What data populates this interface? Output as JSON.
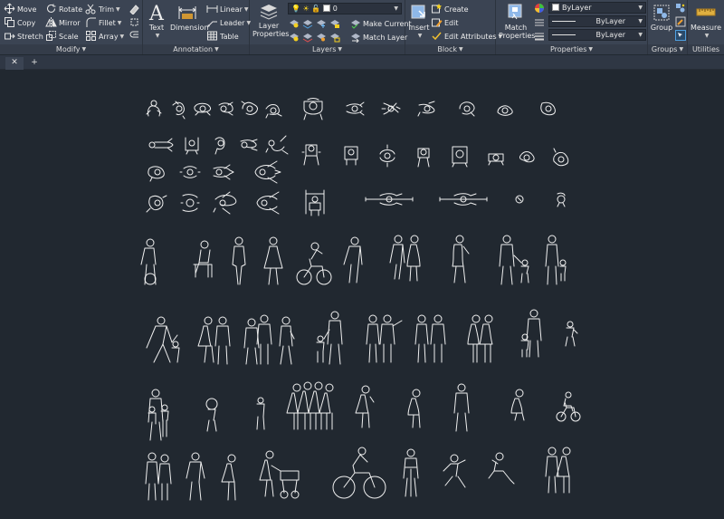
{
  "modify": {
    "title": "Modify",
    "move": "Move",
    "rotate": "Rotate",
    "trim": "Trim",
    "copy": "Copy",
    "mirror": "Mirror",
    "fillet": "Fillet",
    "stretch": "Stretch",
    "scale": "Scale",
    "array": "Array"
  },
  "annotation": {
    "title": "Annotation",
    "text": "Text",
    "dimension": "Dimension",
    "linear": "Linear",
    "leader": "Leader",
    "table": "Table"
  },
  "layers": {
    "title": "Layers",
    "layer_properties_line1": "Layer",
    "layer_properties_line2": "Properties",
    "current_layer": "0",
    "make_current": "Make Current",
    "match_layer": "Match Layer"
  },
  "block": {
    "title": "Block",
    "insert": "Insert",
    "create": "Create",
    "edit": "Edit",
    "edit_attributes": "Edit Attributes"
  },
  "properties": {
    "title": "Properties",
    "match_properties_line1": "Match",
    "match_properties_line2": "Properties",
    "color": "ByLayer",
    "linetype": "ByLayer",
    "lineweight": "ByLayer"
  },
  "groups": {
    "title": "Groups",
    "group": "Group"
  },
  "utilities": {
    "title": "Utilities",
    "measure": "Measure"
  },
  "tabs": {
    "close": "✕",
    "new": "+"
  },
  "colors": {
    "canvas": "#212830",
    "ribbon": "#3b4453",
    "stroke": "#f0f0f0"
  }
}
